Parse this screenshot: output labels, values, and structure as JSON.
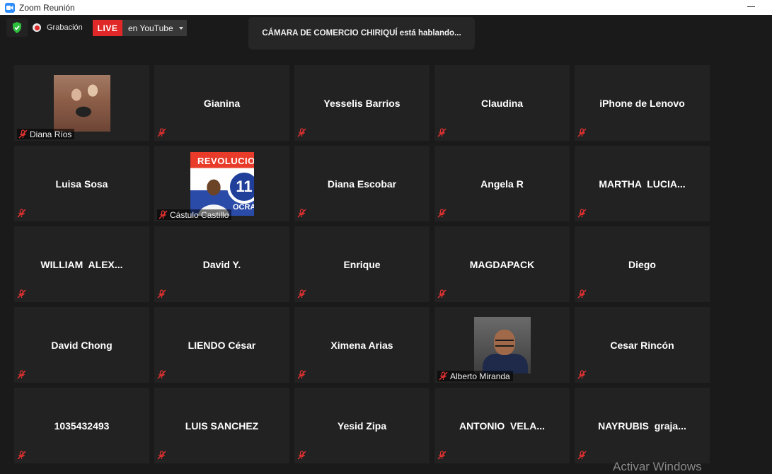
{
  "window": {
    "title": "Zoom Reunión"
  },
  "recording": {
    "label": "Grabación"
  },
  "live": {
    "badge": "LIVE",
    "target": "en YouTube"
  },
  "speaker": {
    "text": "CÁMARA DE COMERCIO CHIRIQUÍ está hablando..."
  },
  "participants": [
    {
      "name": "Diana Ríos",
      "video": true
    },
    {
      "name": "Gianina",
      "video": false
    },
    {
      "name": "Yesselis Barrios",
      "video": false
    },
    {
      "name": "Claudina",
      "video": false
    },
    {
      "name": "iPhone de Lenovo",
      "video": false
    },
    {
      "name": "Luisa Sosa",
      "video": false
    },
    {
      "name": "Cástulo Castillo",
      "video": true
    },
    {
      "name": "Diana Escobar",
      "video": false
    },
    {
      "name": "Angela R",
      "video": false
    },
    {
      "name": "MARTHA  LUCIA...",
      "video": false
    },
    {
      "name": "WILLIAM  ALEX...",
      "video": false
    },
    {
      "name": "David Y.",
      "video": false
    },
    {
      "name": "Enrique",
      "video": false
    },
    {
      "name": "MAGDAPACK",
      "video": false
    },
    {
      "name": "Diego",
      "video": false
    },
    {
      "name": "David Chong",
      "video": false
    },
    {
      "name": "LIENDO César",
      "video": false
    },
    {
      "name": "Ximena Arias",
      "video": false
    },
    {
      "name": "Alberto Miranda",
      "video": true
    },
    {
      "name": "Cesar Rincón",
      "video": false
    },
    {
      "name": "1035432493",
      "video": false
    },
    {
      "name": "LUIS SANCHEZ",
      "video": false
    },
    {
      "name": "Yesid Zipa",
      "video": false
    },
    {
      "name": "ANTONIO  VELA...",
      "video": false
    },
    {
      "name": "NAYRUBIS  graja...",
      "video": false
    }
  ],
  "photo_text": {
    "castulo_banner": "REVOLUCIO",
    "castulo_number": "11",
    "castulo_bottom": "OCRA"
  },
  "watermark": {
    "text": "Activar Windows"
  },
  "colors": {
    "live_red": "#e02828",
    "zoom_blue": "#2d8cff",
    "shield_green": "#2fbf3f",
    "mute_red": "#e03030"
  }
}
